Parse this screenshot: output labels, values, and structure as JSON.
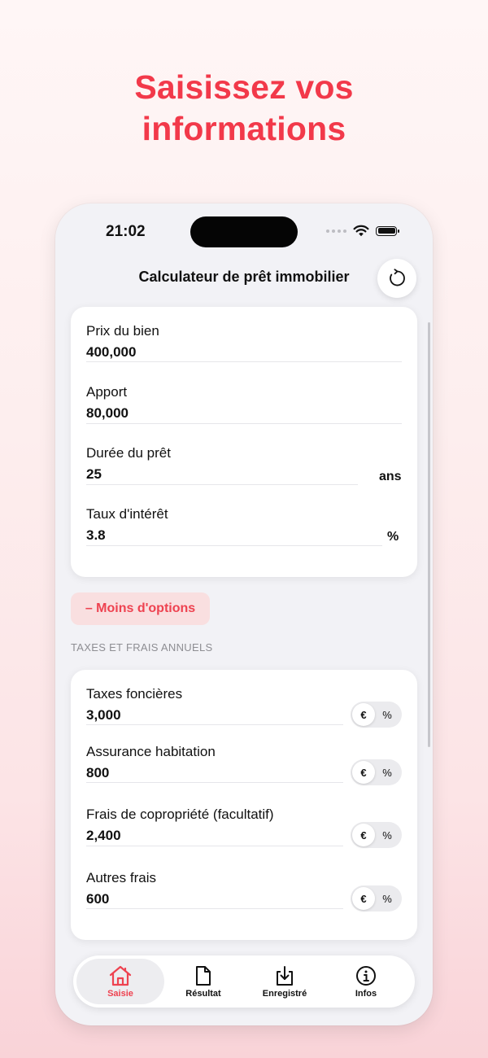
{
  "headline": {
    "line1": "Saisissez vos",
    "line2": "informations"
  },
  "status_bar": {
    "time": "21:02"
  },
  "nav": {
    "title": "Calculateur de prêt immobilier",
    "refresh_icon": "refresh-icon"
  },
  "loan_fields": {
    "price": {
      "label": "Prix du bien",
      "value": "400,000"
    },
    "down_payment": {
      "label": "Apport",
      "value": "80,000"
    },
    "duration": {
      "label": "Durée du prêt",
      "value": "25",
      "unit": "ans"
    },
    "rate": {
      "label": "Taux d'intérêt",
      "value": "3.8",
      "unit": "%"
    }
  },
  "options_button": {
    "label": "– Moins d'options"
  },
  "fees_section": {
    "header": "TAXES ET FRAIS ANNUELS",
    "segment": {
      "euro": "€",
      "percent": "%"
    },
    "items": [
      {
        "label": "Taxes foncières",
        "value": "3,000"
      },
      {
        "label": "Assurance habitation",
        "value": "800"
      },
      {
        "label": "Frais de copropriété (facultatif)",
        "value": "2,400"
      },
      {
        "label": "Autres frais",
        "value": "600"
      }
    ]
  },
  "tabbar": {
    "tabs": [
      {
        "label": "Saisie",
        "icon": "home-icon",
        "active": true
      },
      {
        "label": "Résultat",
        "icon": "document-icon",
        "active": false
      },
      {
        "label": "Enregistré",
        "icon": "download-tray-icon",
        "active": false
      },
      {
        "label": "Infos",
        "icon": "info-icon",
        "active": false
      }
    ]
  },
  "colors": {
    "accent": "#f2394a",
    "button_bg": "#f9dfe0",
    "screen_bg": "#f2f2f6"
  }
}
